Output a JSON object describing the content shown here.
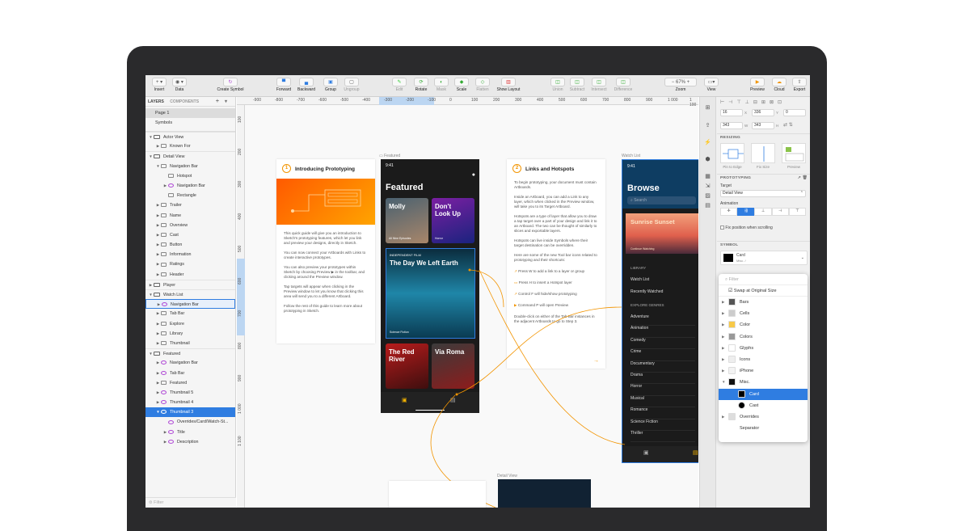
{
  "toolbar": {
    "insert": "Insert",
    "data": "Data",
    "create_symbol": "Create Symbol",
    "forward": "Forward",
    "backward": "Backward",
    "group": "Group",
    "ungroup": "Ungroup",
    "edit": "Edit",
    "rotate": "Rotate",
    "mask": "Mask",
    "scale": "Scale",
    "flatten": "Flatten",
    "show_layout": "Show Layout",
    "union": "Union",
    "subtract": "Subtract",
    "intersect": "Intersect",
    "difference": "Difference",
    "zoom_value": "67%",
    "zoom": "Zoom",
    "view": "View",
    "preview": "Preview",
    "cloud": "Cloud",
    "export": "Export"
  },
  "sidebar": {
    "tab_layers": "LAYERS",
    "tab_components": "COMPONENTS",
    "pages": [
      "Page 1",
      "Symbols"
    ],
    "layers": [
      {
        "label": "Actor View",
        "level": 0,
        "arrow": "▼",
        "type": "ab",
        "grp": true
      },
      {
        "label": "Known For",
        "level": 1,
        "arrow": "▶",
        "type": "folder"
      },
      {
        "label": "Detail View",
        "level": 0,
        "arrow": "▼",
        "type": "ab",
        "grp": true
      },
      {
        "label": "Navigation Bar",
        "level": 1,
        "arrow": "▼",
        "type": "folder"
      },
      {
        "label": "Hotspot",
        "level": 2,
        "arrow": "",
        "type": "hot"
      },
      {
        "label": "Navigation Bar",
        "level": 2,
        "arrow": "▶",
        "type": "sym"
      },
      {
        "label": "Rectangle",
        "level": 2,
        "arrow": "",
        "type": "rect"
      },
      {
        "label": "Trailer",
        "level": 1,
        "arrow": "▶",
        "type": "folder"
      },
      {
        "label": "Name",
        "level": 1,
        "arrow": "▶",
        "type": "folder"
      },
      {
        "label": "Overview",
        "level": 1,
        "arrow": "▶",
        "type": "folder"
      },
      {
        "label": "Cast",
        "level": 1,
        "arrow": "▶",
        "type": "folder"
      },
      {
        "label": "Button",
        "level": 1,
        "arrow": "▶",
        "type": "folder"
      },
      {
        "label": "Information",
        "level": 1,
        "arrow": "▶",
        "type": "folder"
      },
      {
        "label": "Ratings",
        "level": 1,
        "arrow": "▶",
        "type": "folder"
      },
      {
        "label": "Header",
        "level": 1,
        "arrow": "▶",
        "type": "folder"
      },
      {
        "label": "Player",
        "level": 0,
        "arrow": "▶",
        "type": "ab",
        "grp": true
      },
      {
        "label": "Watch List",
        "level": 0,
        "arrow": "▼",
        "type": "ab",
        "grp": true
      },
      {
        "label": "Navigation Bar",
        "level": 1,
        "arrow": "▶",
        "type": "sym",
        "state": "hl"
      },
      {
        "label": "Tab Bar",
        "level": 1,
        "arrow": "▶",
        "type": "folder"
      },
      {
        "label": "Explore",
        "level": 1,
        "arrow": "▶",
        "type": "folder"
      },
      {
        "label": "Library",
        "level": 1,
        "arrow": "▶",
        "type": "folder"
      },
      {
        "label": "Thumbnail",
        "level": 1,
        "arrow": "▶",
        "type": "folder"
      },
      {
        "label": "Featured",
        "level": 0,
        "arrow": "▼",
        "type": "ab",
        "grp": true
      },
      {
        "label": "Navigation Bar",
        "level": 1,
        "arrow": "▶",
        "type": "sym"
      },
      {
        "label": "Tab Bar",
        "level": 1,
        "arrow": "▶",
        "type": "sym"
      },
      {
        "label": "Featured",
        "level": 1,
        "arrow": "▶",
        "type": "folder"
      },
      {
        "label": "Thumbnail 5",
        "level": 1,
        "arrow": "▶",
        "type": "sym"
      },
      {
        "label": "Thumbnail 4",
        "level": 1,
        "arrow": "▶",
        "type": "sym"
      },
      {
        "label": "Thumbnail 3",
        "level": 1,
        "arrow": "▼",
        "type": "sym",
        "state": "sel"
      },
      {
        "label": "Overrides/Card/Watch-St...",
        "level": 2,
        "arrow": "",
        "type": "sym"
      },
      {
        "label": "Title",
        "level": 2,
        "arrow": "▶",
        "type": "sym"
      },
      {
        "label": "Description",
        "level": 2,
        "arrow": "▶",
        "type": "sym"
      }
    ],
    "filter_placeholder": "Filter"
  },
  "ruler": {
    "h": [
      "-900",
      "-800",
      "-700",
      "-600",
      "-500",
      "-400",
      "-300",
      "-200",
      "-100",
      "0",
      "100",
      "200",
      "300",
      "400",
      "500",
      "600",
      "700",
      "800",
      "900",
      "1 000",
      "1 100"
    ],
    "v": [
      "100",
      "200",
      "300",
      "400",
      "500",
      "600",
      "700",
      "800",
      "900",
      "1 000",
      "1 100"
    ]
  },
  "canvas": {
    "intro": {
      "num": "1",
      "title": "Introducing Prototyping",
      "paras": [
        "This quick guide will give you an introduction to Sketch's prototyping features, which let you link and preview your designs, directly in Sketch.",
        "You can now connect your Artboards with Links to create interactive prototypes.",
        "You can also preview your prototypes within Sketch by choosing Preview ▶ in the toolbar, and clicking around the Preview window.",
        "Tap targets will appear when clicking in the Preview window to let you know that clicking this area will send you to a different Artboard.",
        "Follow the rest of this guide to learn more about prototyping in Sketch."
      ]
    },
    "featured": {
      "label": "Featured",
      "time": "9:41",
      "title": "Featured",
      "tiles": [
        {
          "title": "Molly",
          "sub": "All Nine Episodes"
        },
        {
          "title": "Don't Look Up",
          "sub": "Horror"
        }
      ],
      "hero": {
        "tag": "INDEPENDENT FILM",
        "title": "The Day We Left Earth",
        "sub": "Science Fiction"
      },
      "tiles2": [
        {
          "title": "The Red River"
        },
        {
          "title": "Via Roma"
        }
      ]
    },
    "links": {
      "num": "2",
      "title": "Links and Hotspots",
      "paras": [
        "To begin prototyping, your document must contain Artboards.",
        "Inside an Artboard, you can add a Link to any layer, which when clicked in the Preview window, will take you to its Target Artboard.",
        "Hotspots are a type of layer that allow you to draw a tap target over a part of your design and link it to an Artboard. The two can be thought of similarly to slices and exportable layers.",
        "Hotspots can live inside Symbols where their target destination can be overridden.",
        "Here are some of the new Tool bar icons related to prototyping and their shortcuts:"
      ],
      "shortcuts": [
        "Press  W  to add a link to a layer or group",
        "Press  H  to insert a Hotspot layer",
        "Control  F  will hide/show prototyping",
        "Command  P  will open Preview"
      ],
      "footer": "Double-click on either of the Tab Bar instances in the adjacent Artboards to go to Step 3."
    },
    "watch": {
      "label": "Watch List",
      "time": "9:41",
      "title": "Browse",
      "search": "Search",
      "hero": "Sunrise Sunset",
      "hero_sub": "Continue Watching",
      "sec1": "LIBRARY",
      "lib": [
        "Watch List",
        "Recently Watched"
      ],
      "sec2": "EXPLORE GENRES",
      "genres": [
        "Adventure",
        "Animation",
        "Comedy",
        "Crime",
        "Documentary",
        "Drama",
        "Horror",
        "Musical",
        "Romance",
        "Science Fiction",
        "Thriller"
      ]
    },
    "detail_label": "Detail View"
  },
  "inspector": {
    "x": "16",
    "y": "336",
    "rot": "0",
    "w": "343",
    "h": "343",
    "xl": "X",
    "yl": "Y",
    "wl": "W",
    "hl": "H",
    "resizing": "RESIZING",
    "pin": "Pin to Edge",
    "fix": "Fix Size",
    "preview": "Preview",
    "prototyping": "PROTOTYPING",
    "target": "Target",
    "target_val": "Detail View",
    "animation": "Animation",
    "fix_scroll": "Fix position when scrolling",
    "symbol": "SYMBOL",
    "symbol_name": "Card",
    "symbol_sub": "Misc. /"
  },
  "dropdown": {
    "filter": "Filter",
    "swap": "Swap at Original Size",
    "items": [
      {
        "label": "Bars",
        "sw": "#555"
      },
      {
        "label": "Cells",
        "sw": "#ccc"
      },
      {
        "label": "Color",
        "sw": "#f7c948"
      },
      {
        "label": "Colors",
        "sw": "#999"
      },
      {
        "label": "Glyphs",
        "sw": "#fff"
      },
      {
        "label": "Icons",
        "sw": "#eee"
      },
      {
        "label": "iPhone",
        "sw": "#f3f3f3"
      },
      {
        "label": "Misc.",
        "sw": "#111"
      },
      {
        "label": "Card",
        "sw": "#000",
        "sel": true,
        "sub": true
      },
      {
        "label": "Cast",
        "sw": "#000",
        "sub": true,
        "round": true
      },
      {
        "label": "Overrides",
        "sw": "#ddd"
      },
      {
        "label": "Separator",
        "sw": ""
      }
    ]
  },
  "colors": {
    "accent": "#f29400",
    "select": "#2f7de1",
    "dark": "#1b1b1b"
  }
}
